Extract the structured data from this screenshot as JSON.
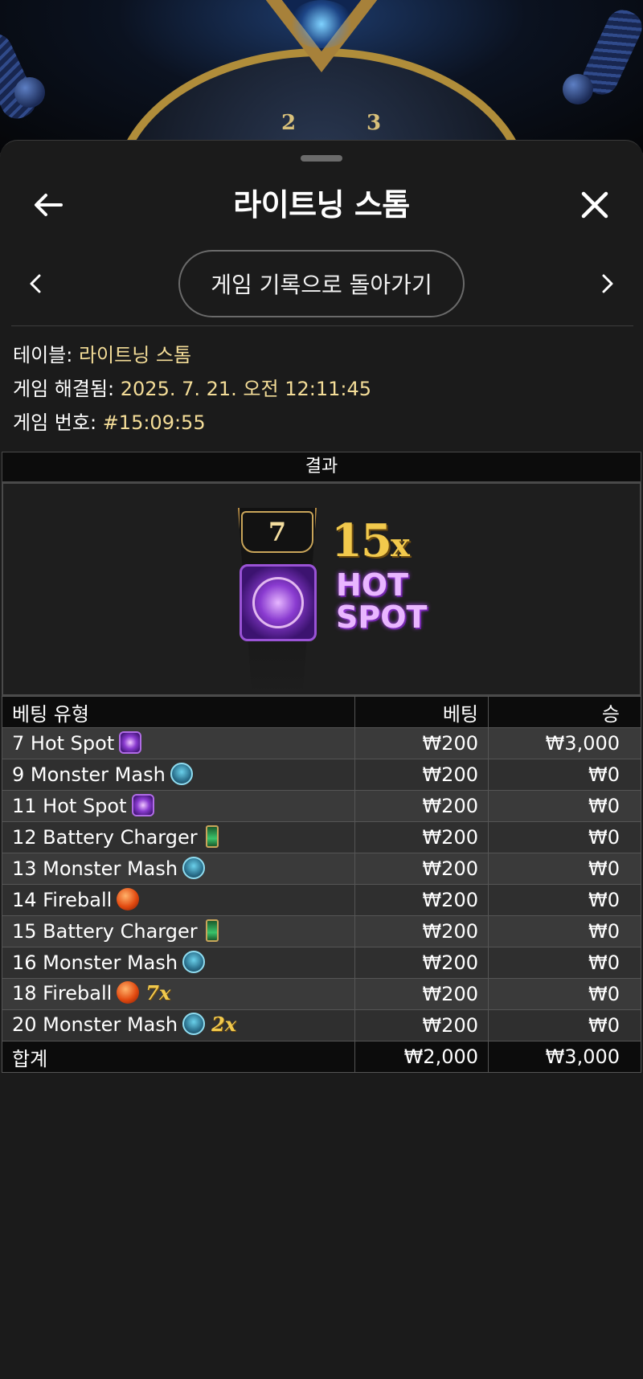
{
  "background": {
    "wheel_numbers": [
      "2",
      "3"
    ]
  },
  "header": {
    "title": "라이트닝 스톰",
    "back_icon": "arrow-left-icon",
    "close_icon": "close-icon"
  },
  "nav": {
    "prev_icon": "chevron-left-icon",
    "next_icon": "chevron-right-icon",
    "back_to_history": "게임 기록으로 돌아가기"
  },
  "info": {
    "table_label": "테이블:",
    "table_value": "라이트닝 스톰",
    "resolved_label": "게임 해결됨:",
    "resolved_value": "2025. 7. 21. 오전 12:11:45",
    "game_no_label": "게임 번호:",
    "game_no_value": "#15:09:55"
  },
  "result": {
    "heading": "결과",
    "number": "7",
    "multiplier": "15",
    "multiplier_suffix": "x",
    "feature_line1": "HOT",
    "feature_line2": "SPOT"
  },
  "bets": {
    "columns": [
      "베팅 유형",
      "베팅",
      "승"
    ],
    "rows": [
      {
        "type": "7 Hot Spot",
        "icon": "hotspot-icon",
        "multiplier": "",
        "bet": "₩200",
        "win": "₩3,000"
      },
      {
        "type": "9 Monster Mash",
        "icon": "monster-icon",
        "multiplier": "",
        "bet": "₩200",
        "win": "₩0"
      },
      {
        "type": "11 Hot Spot",
        "icon": "hotspot-icon",
        "multiplier": "",
        "bet": "₩200",
        "win": "₩0"
      },
      {
        "type": "12 Battery Charger",
        "icon": "battery-icon",
        "multiplier": "",
        "bet": "₩200",
        "win": "₩0"
      },
      {
        "type": "13 Monster Mash",
        "icon": "monster-icon",
        "multiplier": "",
        "bet": "₩200",
        "win": "₩0"
      },
      {
        "type": "14 Fireball",
        "icon": "fireball-icon",
        "multiplier": "",
        "bet": "₩200",
        "win": "₩0"
      },
      {
        "type": "15 Battery Charger",
        "icon": "battery-icon",
        "multiplier": "",
        "bet": "₩200",
        "win": "₩0"
      },
      {
        "type": "16 Monster Mash",
        "icon": "monster-icon",
        "multiplier": "",
        "bet": "₩200",
        "win": "₩0"
      },
      {
        "type": "18 Fireball",
        "icon": "fireball-icon",
        "multiplier": "7x",
        "bet": "₩200",
        "win": "₩0"
      },
      {
        "type": "20 Monster Mash",
        "icon": "monster-icon",
        "multiplier": "2x",
        "bet": "₩200",
        "win": "₩0"
      }
    ],
    "total": {
      "label": "합계",
      "bet": "₩2,000",
      "win": "₩3,000"
    }
  }
}
